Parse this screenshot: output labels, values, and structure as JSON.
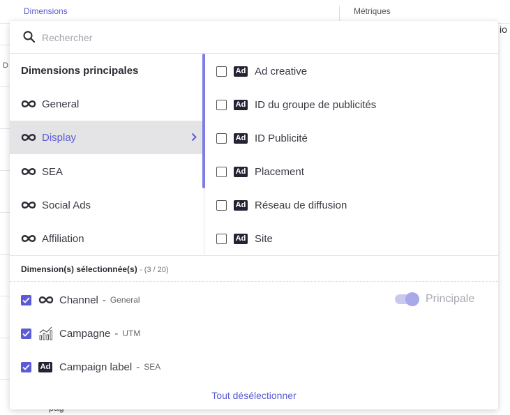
{
  "background": {
    "tab_dimensions": "Dimensions",
    "tab_metriques": "Métriques",
    "edge_text": "io",
    "left_text": "D",
    "bottom_text": "pag"
  },
  "search": {
    "placeholder": "Rechercher",
    "icon": "search-icon"
  },
  "categories": {
    "heading": "Dimensions principales",
    "items": [
      {
        "label": "General",
        "icon": "infinity-icon"
      },
      {
        "label": "Display",
        "icon": "infinity-icon",
        "active": true
      },
      {
        "label": "SEA",
        "icon": "infinity-icon"
      },
      {
        "label": "Social Ads",
        "icon": "infinity-icon"
      },
      {
        "label": "Affiliation",
        "icon": "infinity-icon"
      }
    ]
  },
  "options": {
    "badge": "Ad",
    "items": [
      {
        "label": "Ad creative",
        "checked": false
      },
      {
        "label": "ID du groupe de publicités",
        "checked": false
      },
      {
        "label": "ID Publicité",
        "checked": false
      },
      {
        "label": "Placement",
        "checked": false
      },
      {
        "label": "Réseau de diffusion",
        "checked": false
      },
      {
        "label": "Site",
        "checked": false
      }
    ]
  },
  "selected": {
    "title": "Dimension(s) sélectionnée(s)",
    "count": "- (3 / 20)",
    "items": [
      {
        "label": "Channel",
        "dash": "-",
        "category": "General",
        "icon": "infinity-icon",
        "checked": true
      },
      {
        "label": "Campagne",
        "dash": "-",
        "category": "UTM",
        "icon": "chart-icon",
        "checked": true
      },
      {
        "label": "Campaign label",
        "dash": "-",
        "category": "SEA",
        "icon": "ad-icon",
        "badge": "Ad",
        "checked": true
      }
    ],
    "principal_label": "Principale",
    "principal_on": true
  },
  "footer": {
    "deselect_all": "Tout désélectionner"
  },
  "colors": {
    "accent": "#5b5bd6",
    "active_bg": "#e4e4e7",
    "badge_bg": "#232333"
  }
}
